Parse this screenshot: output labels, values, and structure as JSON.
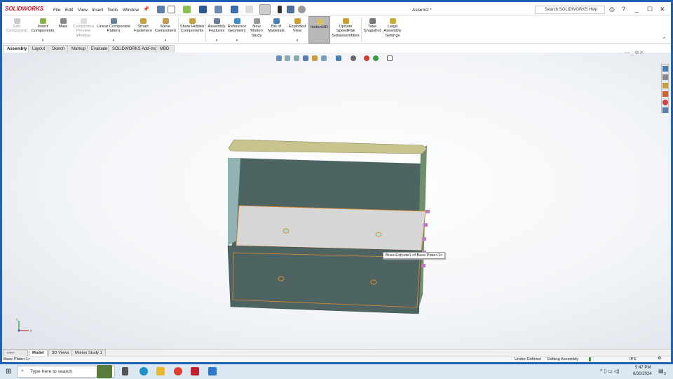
{
  "app": {
    "logo": "SOLIDWORKS",
    "title": "Assem2 *"
  },
  "menu": [
    "File",
    "Edit",
    "View",
    "Insert",
    "Tools",
    "Window"
  ],
  "help_search": {
    "placeholder": "Search SOLIDWORKS Help"
  },
  "window_controls": {
    "minimize": "_",
    "maximize": "☐",
    "close": "✕"
  },
  "ribbon": [
    {
      "label": "Edit Component",
      "disabled": true
    },
    {
      "label": "Insert Components",
      "dropdown": true
    },
    {
      "label": "Mate"
    },
    {
      "label": "Component Preview Window",
      "disabled": true
    },
    {
      "label": "Linear Component Pattern",
      "dropdown": true
    },
    {
      "label": "Smart Fasteners"
    },
    {
      "label": "Move Component",
      "dropdown": true
    },
    {
      "label": "Show Hidden Components"
    },
    {
      "label": "Assembly Features",
      "dropdown": true
    },
    {
      "label": "Reference Geometry",
      "dropdown": true
    },
    {
      "label": "New Motion Study"
    },
    {
      "label": "Bill of Materials"
    },
    {
      "label": "Exploded View",
      "dropdown": true
    },
    {
      "label": "Instant3D",
      "active": true
    },
    {
      "label": "Update SpeedPak Subassemblies"
    },
    {
      "label": "Take Snapshot"
    },
    {
      "label": "Large Assembly Settings"
    }
  ],
  "tabs": [
    "Assembly",
    "Layout",
    "Sketch",
    "Markup",
    "Evaluate",
    "SOLIDWORKS Add-Ins",
    "MBD"
  ],
  "active_tab": "Assembly",
  "tooltip": "Boss-Extrude1 of Base Plate<1>",
  "triad": {
    "x": "x",
    "y": "y"
  },
  "bottom_tabs": [
    "Model",
    "3D Views",
    "Motion Study 1"
  ],
  "status": {
    "selection": "Base Plate<1>",
    "state": "Under Defined",
    "mode": "Editing Assembly",
    "units": "IPS"
  },
  "taskbar": {
    "search_placeholder": "Type here to search",
    "time": "5:47 PM",
    "date": "8/30/2024",
    "notifications": "3"
  },
  "colors": {
    "accent": "#1f5fb8",
    "box": "#4e6462",
    "lid": "#c9c48e",
    "plate": "#d6d6d6",
    "highlight": "#e08a2a"
  }
}
